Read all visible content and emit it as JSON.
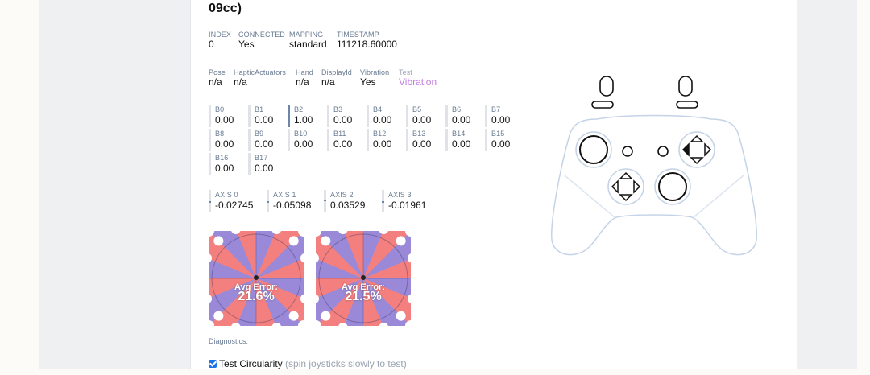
{
  "title": "09cc)",
  "info": {
    "index_label": "INDEX",
    "index": "0",
    "connected_label": "CONNECTED",
    "connected": "Yes",
    "mapping_label": "MAPPING",
    "mapping": "standard",
    "timestamp_label": "TIMESTAMP",
    "timestamp": "111218.60000"
  },
  "props": {
    "pose_label": "Pose",
    "pose": "n/a",
    "haptic_label": "HapticActuators",
    "haptic": "n/a",
    "hand_label": "Hand",
    "hand": "n/a",
    "displayid_label": "DisplayId",
    "displayid": "n/a",
    "vibration_label": "Vibration",
    "vibration": "Yes",
    "test_label": "Test",
    "test_link": "Vibration"
  },
  "buttons": [
    {
      "name": "B0",
      "value": "0.00"
    },
    {
      "name": "B1",
      "value": "0.00"
    },
    {
      "name": "B2",
      "value": "1.00"
    },
    {
      "name": "B3",
      "value": "0.00"
    },
    {
      "name": "B4",
      "value": "0.00"
    },
    {
      "name": "B5",
      "value": "0.00"
    },
    {
      "name": "B6",
      "value": "0.00"
    },
    {
      "name": "B7",
      "value": "0.00"
    },
    {
      "name": "B8",
      "value": "0.00"
    },
    {
      "name": "B9",
      "value": "0.00"
    },
    {
      "name": "B10",
      "value": "0.00"
    },
    {
      "name": "B11",
      "value": "0.00"
    },
    {
      "name": "B12",
      "value": "0.00"
    },
    {
      "name": "B13",
      "value": "0.00"
    },
    {
      "name": "B14",
      "value": "0.00"
    },
    {
      "name": "B15",
      "value": "0.00"
    },
    {
      "name": "B16",
      "value": "0.00"
    },
    {
      "name": "B17",
      "value": "0.00"
    }
  ],
  "axes": [
    {
      "name": "AXIS 0",
      "value": "-0.02745"
    },
    {
      "name": "AXIS 1",
      "value": "-0.05098"
    },
    {
      "name": "AXIS 2",
      "value": "0.03529"
    },
    {
      "name": "AXIS 3",
      "value": "-0.01961"
    }
  ],
  "circularity": [
    {
      "error_label": "Avg Error:",
      "error_value": "21.6%"
    },
    {
      "error_label": "Avg Error:",
      "error_value": "21.5%"
    }
  ],
  "diagnostics_label": "Diagnostics:",
  "test_circularity": {
    "label": "Test Circularity",
    "hint": "(spin joysticks slowly to test)",
    "checked": true
  },
  "colors": {
    "accent": "#6a87a8",
    "error_fill": "#f47f7f",
    "ok_fill": "#7b8cf5",
    "link": "#c27fe0",
    "checkbox": "#1a73e8",
    "controller_stroke": "#c4d3e6"
  }
}
